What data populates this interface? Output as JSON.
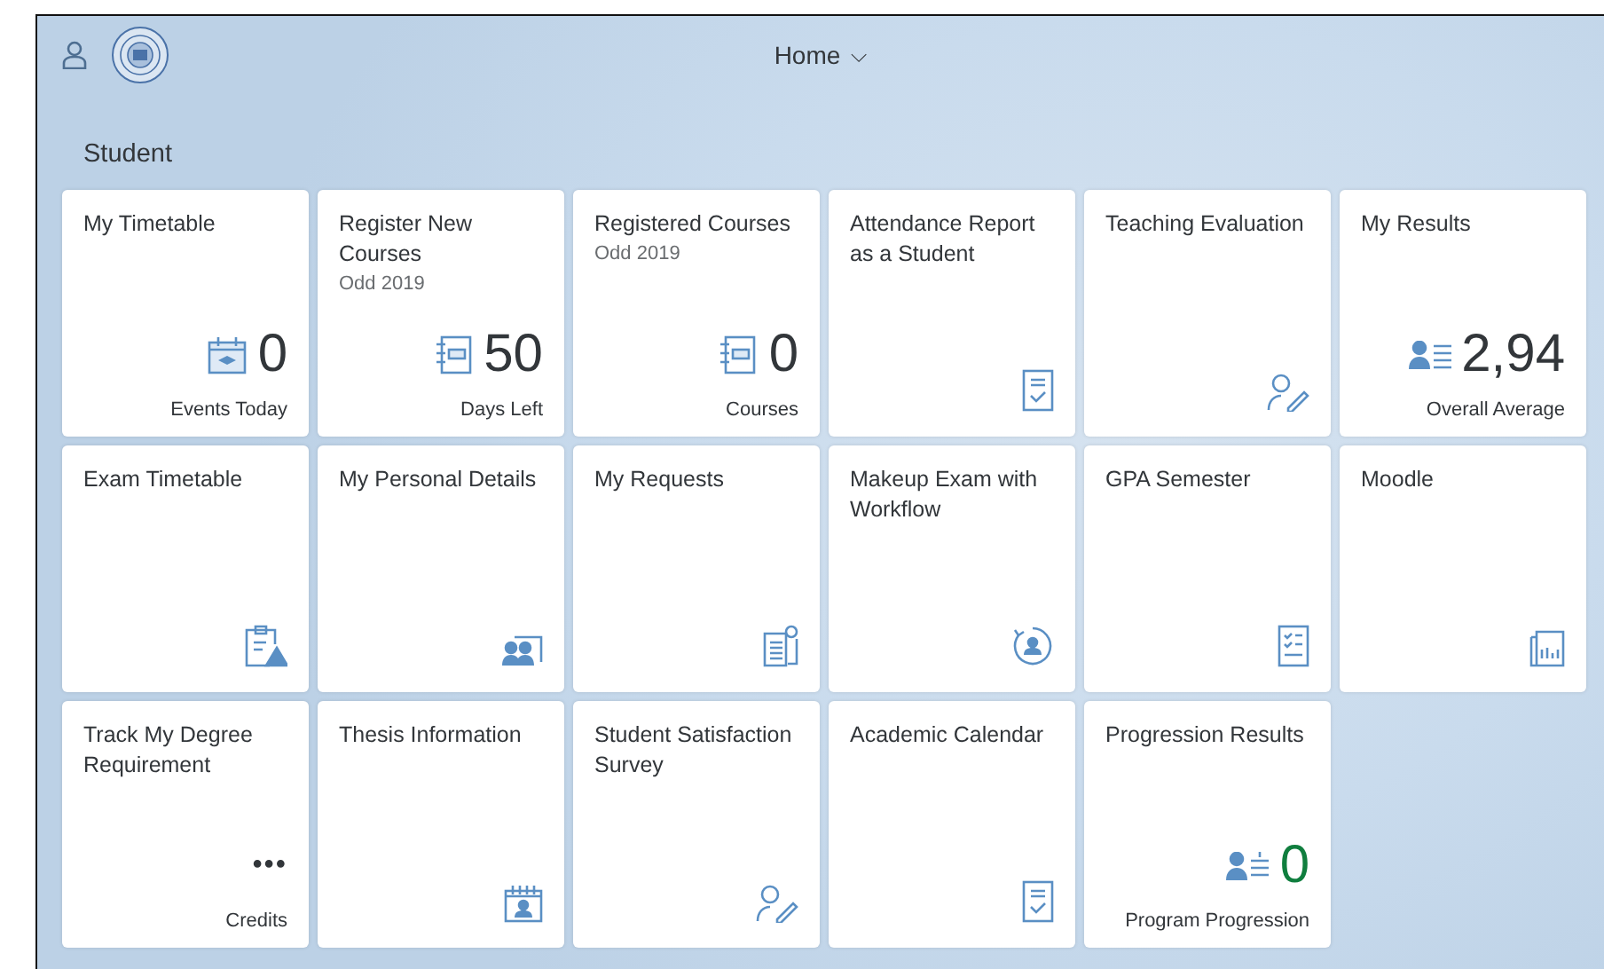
{
  "header": {
    "title": "Home",
    "menu_caret": "⌵"
  },
  "group": {
    "title": "Student"
  },
  "tiles": [
    {
      "kind": "numeric",
      "title": "My Timetable",
      "number": "0",
      "footer": "Events Today",
      "positive": false
    },
    {
      "kind": "numeric",
      "title": "Register New Courses",
      "subtitle": "Odd 2019",
      "number": "50",
      "footer": "Days Left",
      "positive": false
    },
    {
      "kind": "numeric",
      "title": "Registered Courses",
      "subtitle": "Odd 2019",
      "number": "0",
      "footer": "Courses",
      "positive": false
    },
    {
      "kind": "launch",
      "title": "Attendance Report as a Student"
    },
    {
      "kind": "launch",
      "title": "Teaching Evaluation"
    },
    {
      "kind": "numeric",
      "title": "My Results",
      "number": "2,94",
      "footer": "Overall Average",
      "positive": false
    },
    {
      "kind": "launch",
      "title": "Exam Timetable"
    },
    {
      "kind": "launch",
      "title": "My Personal Details"
    },
    {
      "kind": "launch",
      "title": "My Requests"
    },
    {
      "kind": "launch",
      "title": "Makeup Exam with Workflow"
    },
    {
      "kind": "launch",
      "title": "GPA Semester"
    },
    {
      "kind": "launch",
      "title": "Moodle"
    },
    {
      "kind": "numeric",
      "title": "Track My Degree Requirement",
      "number": "•••",
      "footer": "Credits",
      "positive": false
    },
    {
      "kind": "launch",
      "title": "Thesis Information"
    },
    {
      "kind": "launch",
      "title": "Student Satisfaction Survey"
    },
    {
      "kind": "launch",
      "title": "Academic Calendar"
    },
    {
      "kind": "numeric",
      "title": "Progression Results",
      "number": "0",
      "footer": "Program Progression",
      "positive": true
    }
  ]
}
